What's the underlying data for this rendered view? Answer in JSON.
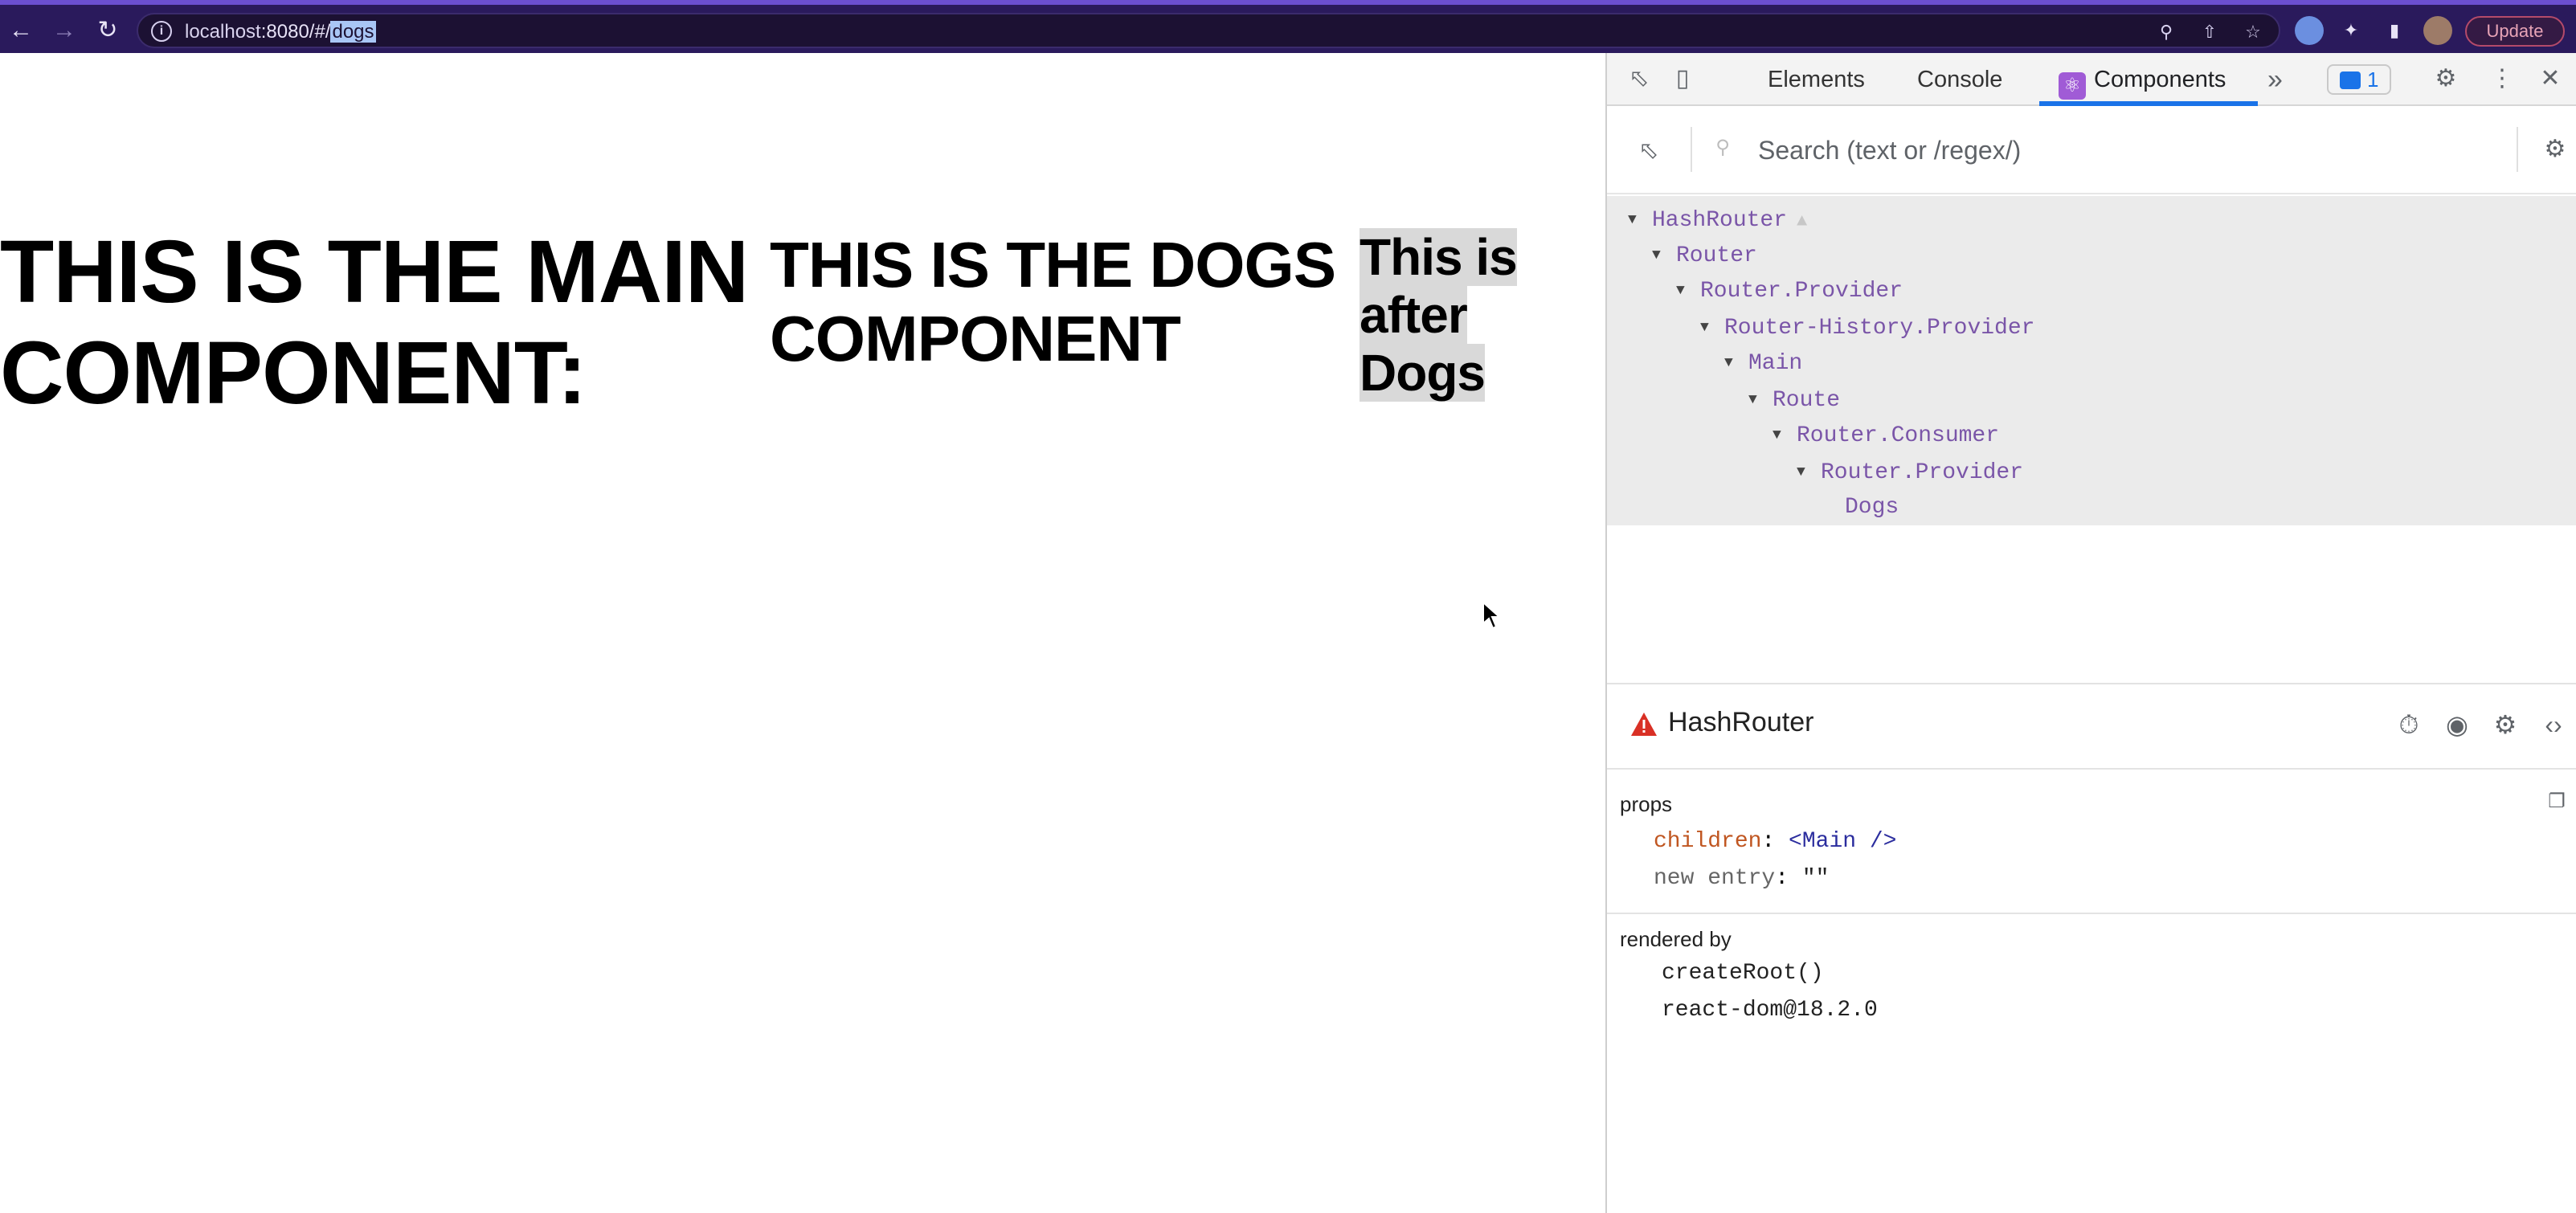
{
  "browser": {
    "url_host": "localhost",
    "url_port_path": ":8080/#/",
    "url_hash": "dogs",
    "info_icon": "i",
    "update_label": "Update"
  },
  "page": {
    "main_heading": "THIS IS THE MAIN COMPONENT:",
    "dogs_heading": "THIS IS THE DOGS COMPONENT",
    "after_text": "This is after Dogs"
  },
  "devtools": {
    "tabs": [
      {
        "label": "Elements"
      },
      {
        "label": "Console"
      },
      {
        "label": "Components"
      }
    ],
    "more_tabs": "»",
    "issues_count": "1",
    "search_placeholder": "Search (text or /regex/)",
    "tree": [
      {
        "name": "HashRouter",
        "expanded": true,
        "selected": true,
        "warning": true
      },
      {
        "name": "Router",
        "expanded": true
      },
      {
        "name": "Router.Provider",
        "expanded": true
      },
      {
        "name": "Router-History.Provider",
        "expanded": true
      },
      {
        "name": "Main",
        "expanded": true
      },
      {
        "name": "Route",
        "expanded": true
      },
      {
        "name": "Router.Consumer",
        "expanded": true
      },
      {
        "name": "Router.Provider",
        "expanded": true
      },
      {
        "name": "Dogs",
        "expanded": false
      }
    ],
    "details": {
      "title": "HashRouter",
      "props_label": "props",
      "props": [
        {
          "key": "children",
          "sep": ": ",
          "value": "<Main />"
        },
        {
          "key": "new entry",
          "sep": ": ",
          "value": "\"\""
        }
      ],
      "rendered_by_label": "rendered by",
      "rendered_by": [
        "createRoot()",
        "react-dom@18.2.0"
      ]
    }
  },
  "colors": {
    "browser_bar": "#2a1a5c",
    "accent": "#1a73e8",
    "tree_component": "#7a55a8",
    "prop_key": "#c05621",
    "prop_value": "#2b2d9e",
    "warning": "#d93025"
  }
}
